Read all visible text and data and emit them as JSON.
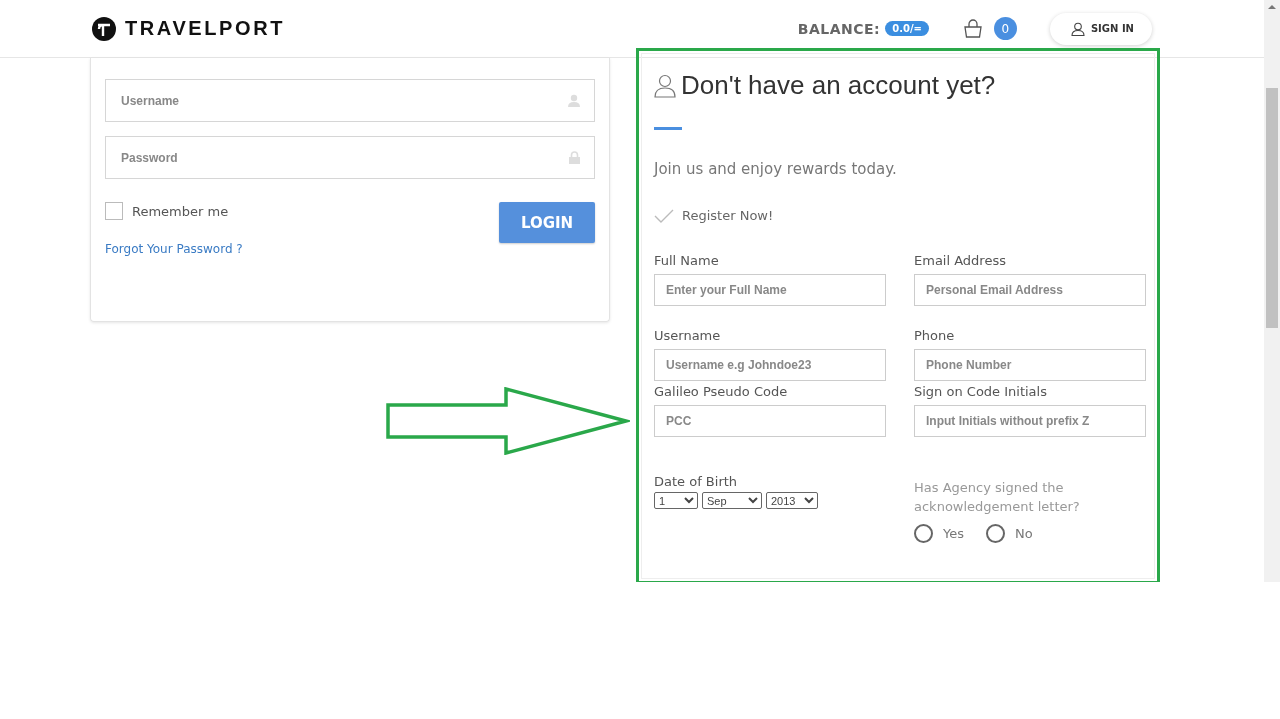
{
  "header": {
    "logo": "TRAVELPORT",
    "balance_label": "BALANCE:",
    "balance_value": "0.0/=",
    "cart_count": "0",
    "sign_in": "SIGN IN"
  },
  "login": {
    "username_placeholder": "Username",
    "password_placeholder": "Password",
    "remember_label": "Remember me",
    "remember_checked": false,
    "login_button": "LOGIN",
    "forgot_link": "Forgot Your Password ?"
  },
  "register": {
    "title": "Don't have an account yet?",
    "subtitle": "Join us and enjoy rewards today.",
    "register_now": "Register Now!",
    "fields": [
      {
        "label": "Full Name",
        "placeholder": "Enter your Full Name"
      },
      {
        "label": "Email Address",
        "placeholder": "Personal Email Address"
      },
      {
        "label": "Username",
        "placeholder": "Username e.g Johndoe23"
      },
      {
        "label": "Phone",
        "placeholder": "Phone Number"
      },
      {
        "label": "Galileo Pseudo Code",
        "placeholder": "PCC"
      },
      {
        "label": "Sign on Code Initials",
        "placeholder": "Input Initials without prefix Z"
      }
    ],
    "dob_label": "Date of Birth",
    "dob": {
      "day": "1",
      "month": "Sep",
      "year": "2013"
    },
    "agency_question": "Has Agency signed the acknowledgement letter?",
    "agency_options": [
      {
        "label": "Yes",
        "selected": false
      },
      {
        "label": "No",
        "selected": false
      }
    ]
  }
}
